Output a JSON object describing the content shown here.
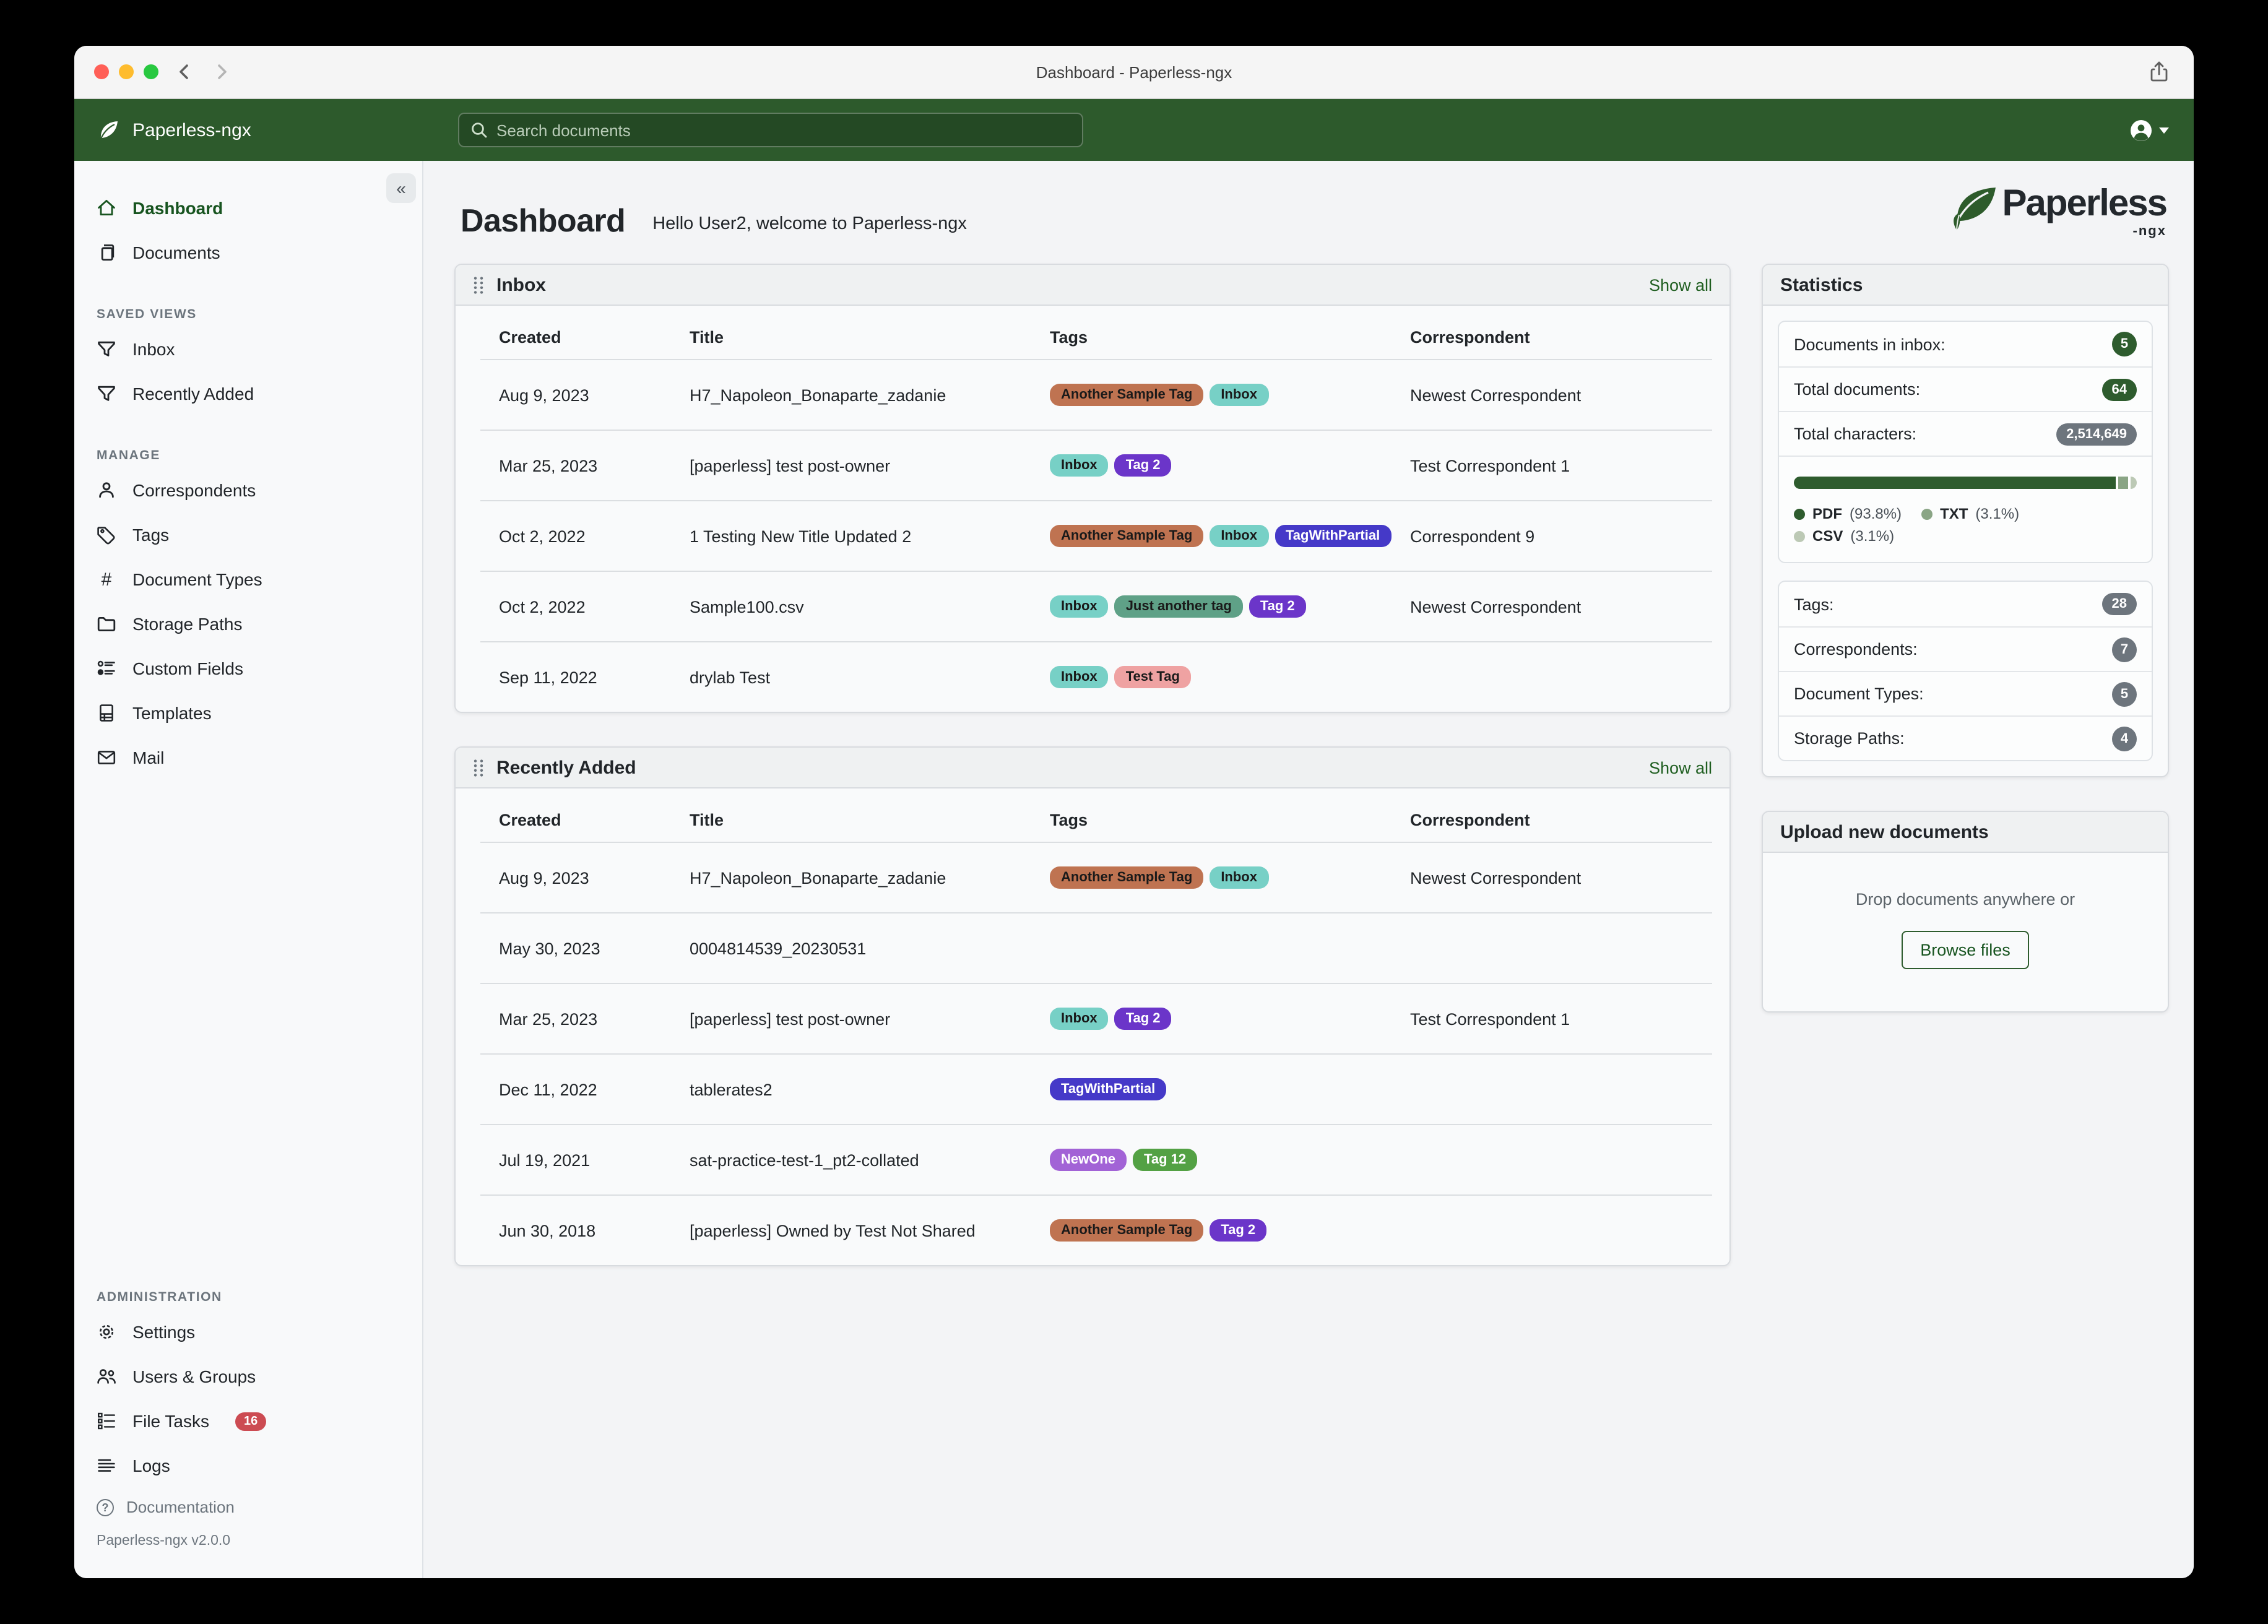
{
  "window": {
    "title": "Dashboard - Paperless-ngx"
  },
  "navbar": {
    "brand": "Paperless-ngx",
    "search_placeholder": "Search documents"
  },
  "sidebar": {
    "dashboard": "Dashboard",
    "documents": "Documents",
    "saved_views_label": "SAVED VIEWS",
    "inbox": "Inbox",
    "recently_added": "Recently Added",
    "manage_label": "MANAGE",
    "correspondents": "Correspondents",
    "tags": "Tags",
    "document_types": "Document Types",
    "storage_paths": "Storage Paths",
    "custom_fields": "Custom Fields",
    "templates": "Templates",
    "mail": "Mail",
    "administration_label": "ADMINISTRATION",
    "settings": "Settings",
    "users_groups": "Users & Groups",
    "file_tasks": "File Tasks",
    "file_tasks_badge": "16",
    "logs": "Logs",
    "documentation": "Documentation",
    "version": "Paperless-ngx v2.0.0"
  },
  "main": {
    "heading": "Dashboard",
    "greeting": "Hello User2, welcome to Paperless-ngx",
    "logo_word": "Paperless",
    "logo_suffix": "-ngx"
  },
  "tag_defs": {
    "another_sample_tag": {
      "label": "Another Sample Tag",
      "bg": "#bf7351",
      "fg": "#1a1a1a"
    },
    "inbox": {
      "label": "Inbox",
      "bg": "#77d0c6",
      "fg": "#1a1a1a"
    },
    "tag2": {
      "label": "Tag 2",
      "bg": "#6b35c9",
      "fg": "#ffffff"
    },
    "tagwithpartial": {
      "label": "TagWithPartial",
      "bg": "#4539c8",
      "fg": "#ffffff"
    },
    "just_another_tag": {
      "label": "Just another tag",
      "bg": "#5fa187",
      "fg": "#1a1a1a"
    },
    "test_tag": {
      "label": "Test Tag",
      "bg": "#efa2a2",
      "fg": "#1a1a1a"
    },
    "newone": {
      "label": "NewOne",
      "bg": "#a263d6",
      "fg": "#ffffff"
    },
    "tag12": {
      "label": "Tag 12",
      "bg": "#53a144",
      "fg": "#ffffff"
    }
  },
  "inbox": {
    "title": "Inbox",
    "show_all": "Show all",
    "columns": [
      "Created",
      "Title",
      "Tags",
      "Correspondent"
    ],
    "rows": [
      {
        "created": "Aug 9, 2023",
        "title": "H7_Napoleon_Bonaparte_zadanie",
        "tags": [
          "another_sample_tag",
          "inbox"
        ],
        "correspondent": "Newest Correspondent"
      },
      {
        "created": "Mar 25, 2023",
        "title": "[paperless] test post-owner",
        "tags": [
          "inbox",
          "tag2"
        ],
        "correspondent": "Test Correspondent 1"
      },
      {
        "created": "Oct 2, 2022",
        "title": "1 Testing New Title Updated 2",
        "tags": [
          "another_sample_tag",
          "inbox",
          "tagwithpartial"
        ],
        "correspondent": "Correspondent 9"
      },
      {
        "created": "Oct 2, 2022",
        "title": "Sample100.csv",
        "tags": [
          "inbox",
          "just_another_tag",
          "tag2"
        ],
        "correspondent": "Newest Correspondent"
      },
      {
        "created": "Sep 11, 2022",
        "title": "drylab Test",
        "tags": [
          "inbox",
          "test_tag"
        ],
        "correspondent": ""
      }
    ]
  },
  "recently_added": {
    "title": "Recently Added",
    "show_all": "Show all",
    "columns": [
      "Created",
      "Title",
      "Tags",
      "Correspondent"
    ],
    "rows": [
      {
        "created": "Aug 9, 2023",
        "title": "H7_Napoleon_Bonaparte_zadanie",
        "tags": [
          "another_sample_tag",
          "inbox"
        ],
        "correspondent": "Newest Correspondent"
      },
      {
        "created": "May 30, 2023",
        "title": "0004814539_20230531",
        "tags": [],
        "correspondent": ""
      },
      {
        "created": "Mar 25, 2023",
        "title": "[paperless] test post-owner",
        "tags": [
          "inbox",
          "tag2"
        ],
        "correspondent": "Test Correspondent 1"
      },
      {
        "created": "Dec 11, 2022",
        "title": "tablerates2",
        "tags": [
          "tagwithpartial"
        ],
        "correspondent": ""
      },
      {
        "created": "Jul 19, 2021",
        "title": "sat-practice-test-1_pt2-collated",
        "tags": [
          "newone",
          "tag12"
        ],
        "correspondent": ""
      },
      {
        "created": "Jun 30, 2018",
        "title": "[paperless] Owned by Test Not Shared",
        "tags": [
          "another_sample_tag",
          "tag2"
        ],
        "correspondent": ""
      }
    ]
  },
  "statistics": {
    "title": "Statistics",
    "rows": [
      {
        "label": "Documents in inbox:",
        "value": "5"
      },
      {
        "label": "Total documents:",
        "value": "64"
      },
      {
        "label": "Total characters:",
        "value": "2,514,649"
      }
    ],
    "chart": {
      "type": "bar",
      "segments": [
        {
          "label": "PDF",
          "pct": 93.8,
          "pct_label": "(93.8%)",
          "color": "#2e5c2e"
        },
        {
          "label": "TXT",
          "pct": 3.1,
          "pct_label": "(3.1%)",
          "color": "#8aa585"
        },
        {
          "label": "CSV",
          "pct": 3.1,
          "pct_label": "(3.1%)",
          "color": "#bcc9b5"
        }
      ]
    },
    "counts": [
      {
        "label": "Tags:",
        "value": "28"
      },
      {
        "label": "Correspondents:",
        "value": "7"
      },
      {
        "label": "Document Types:",
        "value": "5"
      },
      {
        "label": "Storage Paths:",
        "value": "4"
      }
    ]
  },
  "upload": {
    "title": "Upload new documents",
    "drop_text": "Drop documents anywhere or",
    "browse_label": "Browse files"
  }
}
